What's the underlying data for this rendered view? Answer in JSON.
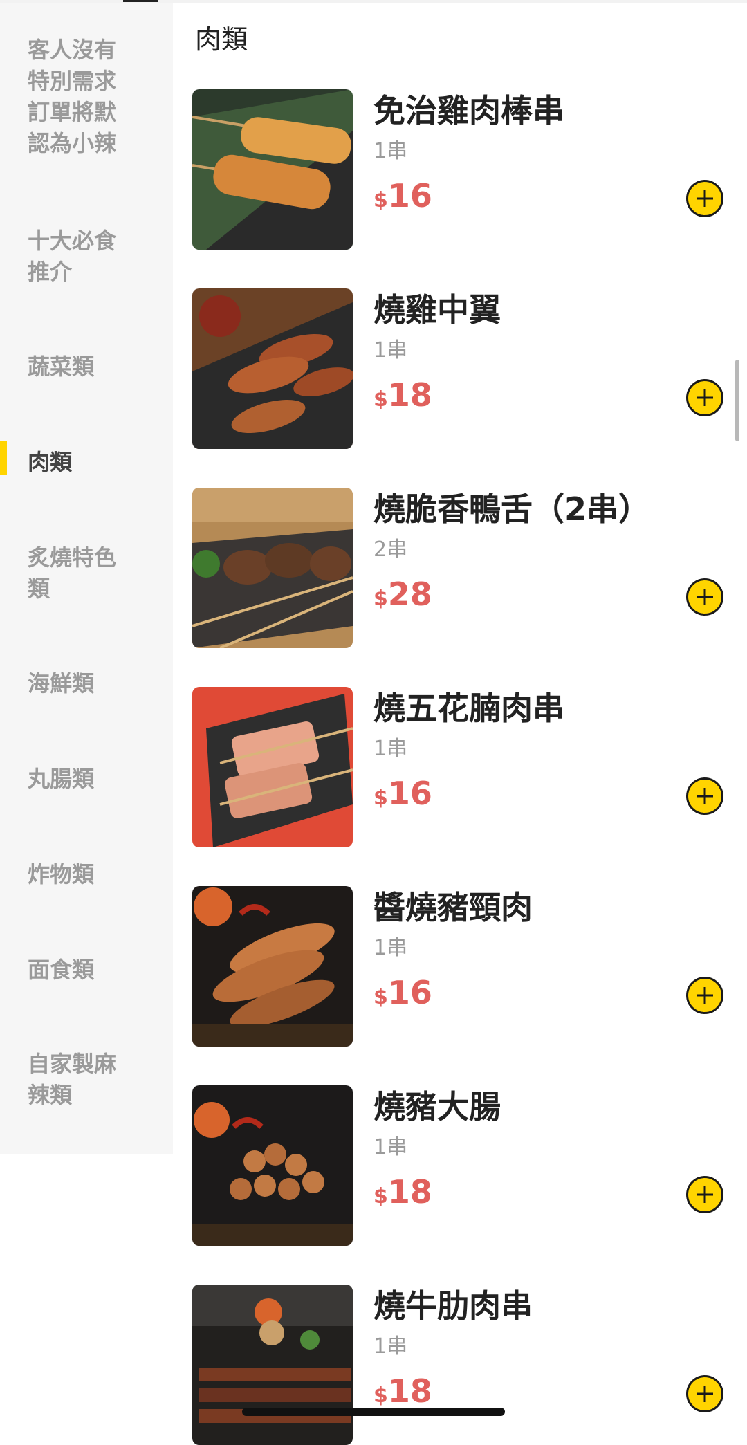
{
  "sidebar": {
    "items": [
      {
        "label": "客人沒有\n特別需求\n訂單將默\n認為小辣"
      },
      {
        "label": "十大必食\n推介"
      },
      {
        "label": "蔬菜類"
      },
      {
        "label": "肉類",
        "active": true
      },
      {
        "label": "炙燒特色\n類"
      },
      {
        "label": "海鮮類"
      },
      {
        "label": "丸腸類"
      },
      {
        "label": "炸物類"
      },
      {
        "label": "面食類"
      },
      {
        "label": "自家製麻\n辣類"
      }
    ]
  },
  "main": {
    "section_title": "肉類",
    "products": [
      {
        "name": "免治雞肉棒串",
        "unit": "1串",
        "currency": "$",
        "price": "16"
      },
      {
        "name": "燒雞中翼",
        "unit": "1串",
        "currency": "$",
        "price": "18"
      },
      {
        "name": "燒脆香鴨舌（2串）",
        "unit": "2串",
        "currency": "$",
        "price": "28"
      },
      {
        "name": "燒五花腩肉串",
        "unit": "1串",
        "currency": "$",
        "price": "16"
      },
      {
        "name": "醬燒豬頸肉",
        "unit": "1串",
        "currency": "$",
        "price": "16"
      },
      {
        "name": "燒豬大腸",
        "unit": "1串",
        "currency": "$",
        "price": "18"
      },
      {
        "name": "燒牛肋肉串",
        "unit": "1串",
        "currency": "$",
        "price": "18"
      }
    ]
  },
  "colors": {
    "accent": "#ffd400",
    "price": "#e0605c",
    "sidebar_bg": "#f6f6f6"
  }
}
